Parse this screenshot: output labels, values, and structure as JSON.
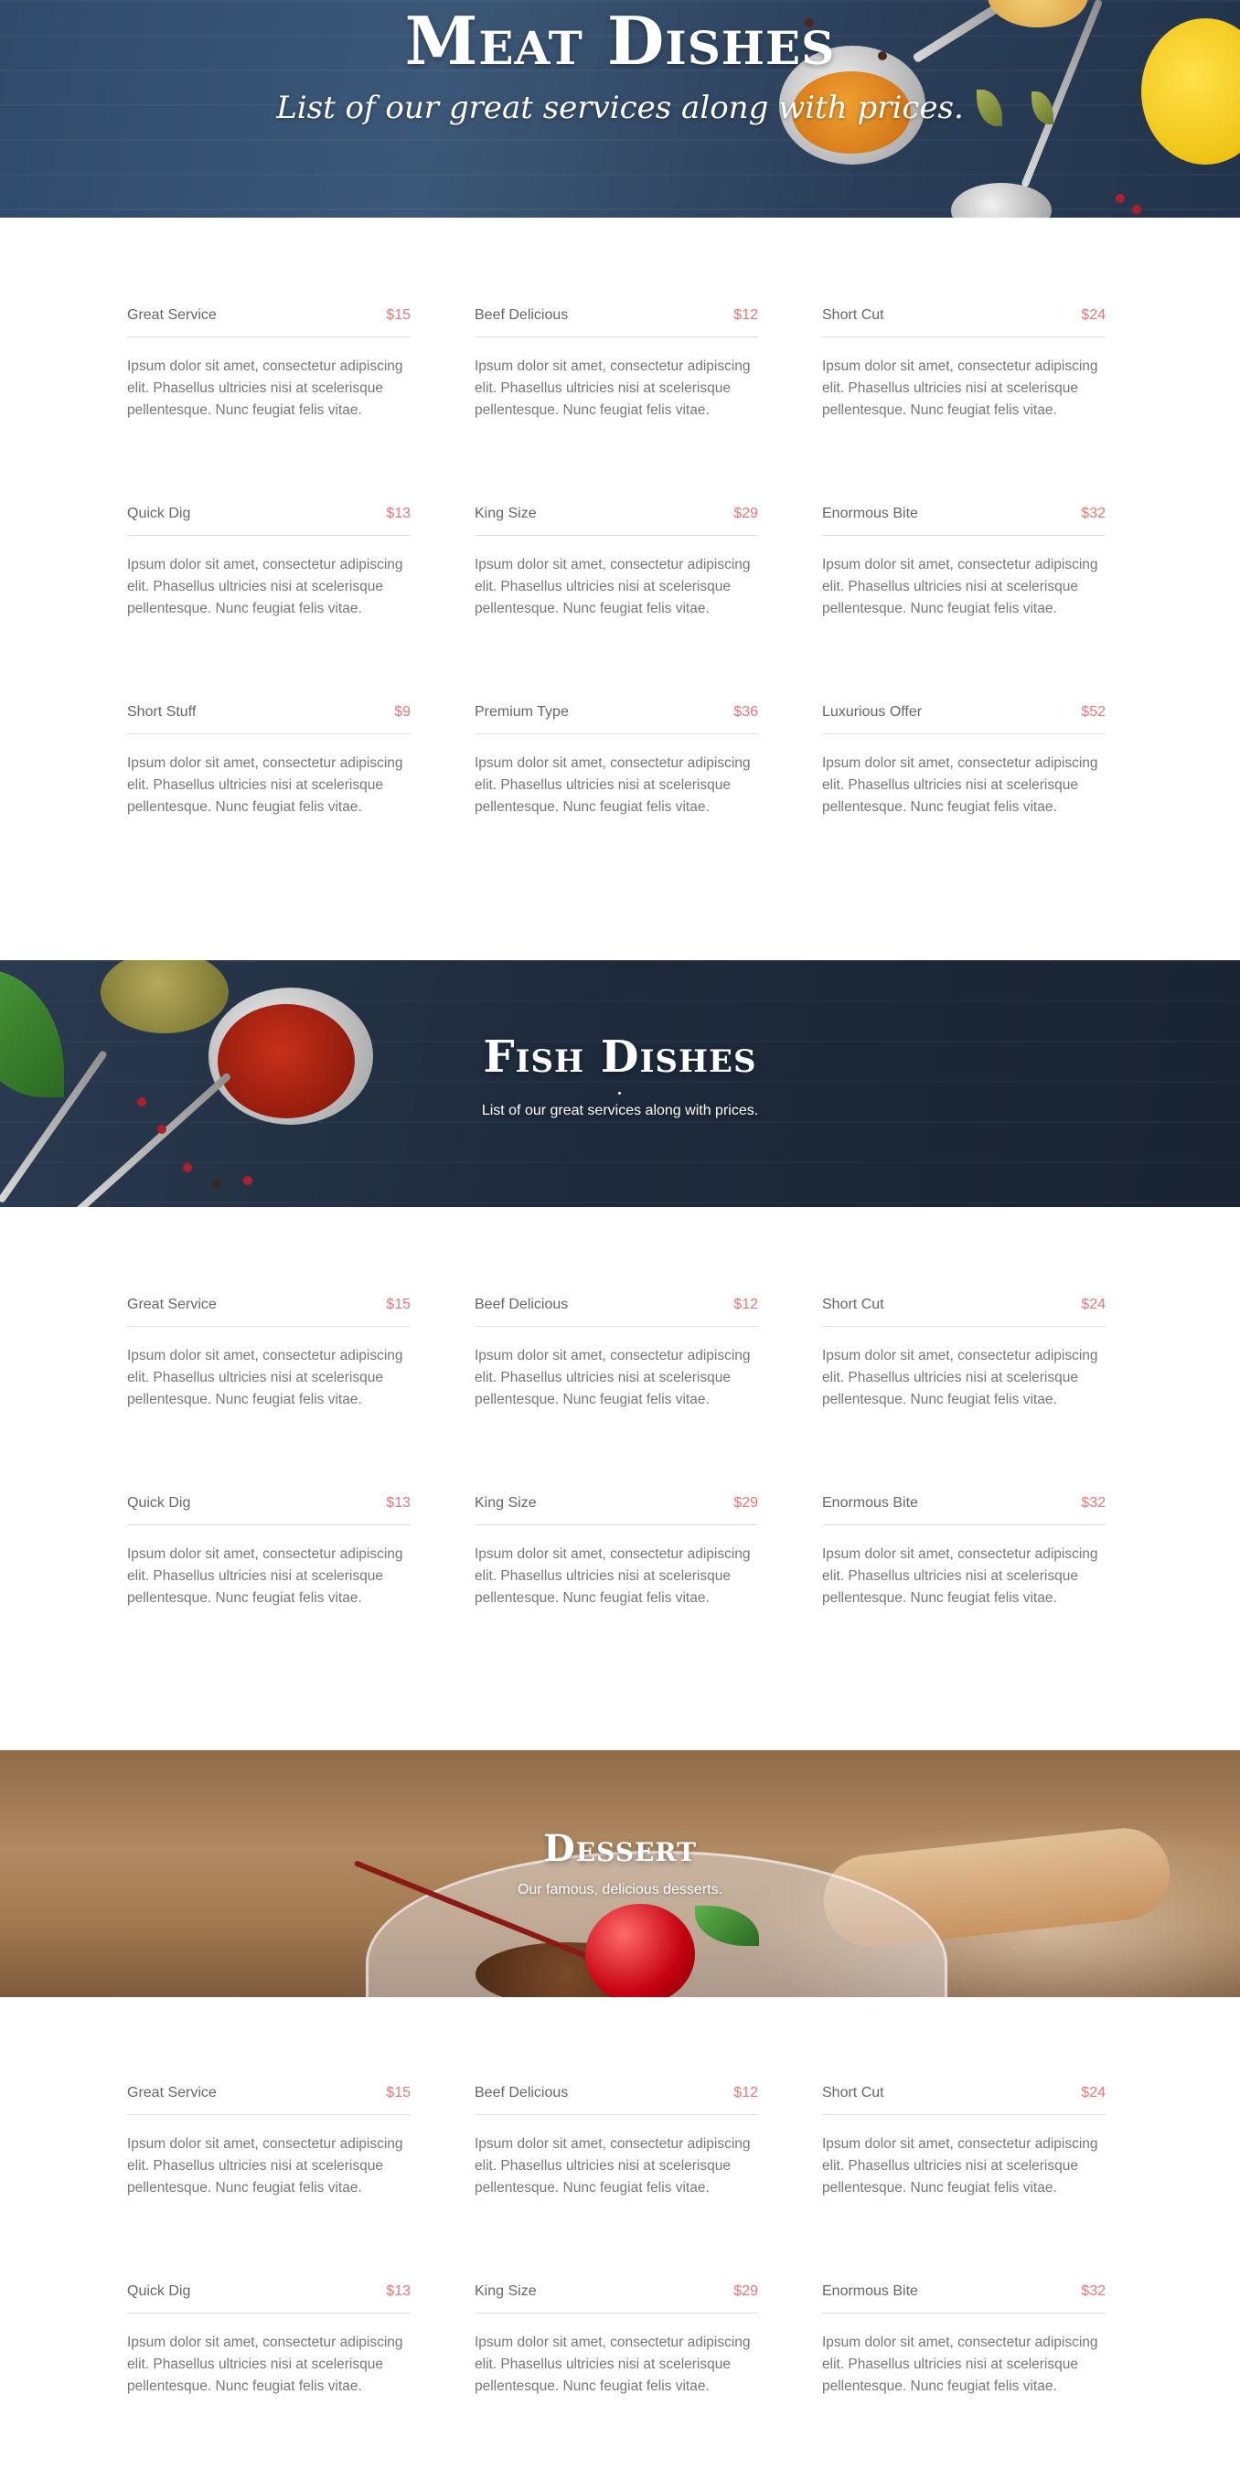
{
  "meat": {
    "title": "Meat Dishes",
    "subtitle": "List of our great services along with prices.",
    "items": [
      {
        "name": "Great Service",
        "price": "$15",
        "desc": "Ipsum dolor sit amet, consectetur adipiscing elit. Phasellus ultricies nisi at scelerisque pellentesque. Nunc feugiat felis vitae."
      },
      {
        "name": "Beef Delicious",
        "price": "$12",
        "desc": "Ipsum dolor sit amet, consectetur adipiscing elit. Phasellus ultricies nisi at scelerisque pellentesque. Nunc feugiat felis vitae."
      },
      {
        "name": "Short Cut",
        "price": "$24",
        "desc": "Ipsum dolor sit amet, consectetur adipiscing elit. Phasellus ultricies nisi at scelerisque pellentesque. Nunc feugiat felis vitae."
      },
      {
        "name": "Quick Dig",
        "price": "$13",
        "desc": "Ipsum dolor sit amet, consectetur adipiscing elit. Phasellus ultricies nisi at scelerisque pellentesque. Nunc feugiat felis vitae."
      },
      {
        "name": "King Size",
        "price": "$29",
        "desc": "Ipsum dolor sit amet, consectetur adipiscing elit. Phasellus ultricies nisi at scelerisque pellentesque. Nunc feugiat felis vitae."
      },
      {
        "name": "Enormous Bite",
        "price": "$32",
        "desc": "Ipsum dolor sit amet, consectetur adipiscing elit. Phasellus ultricies nisi at scelerisque pellentesque. Nunc feugiat felis vitae."
      },
      {
        "name": "Short Stuff",
        "price": "$9",
        "desc": "Ipsum dolor sit amet, consectetur adipiscing elit. Phasellus ultricies nisi at scelerisque pellentesque. Nunc feugiat felis vitae."
      },
      {
        "name": "Premium Type",
        "price": "$36",
        "desc": "Ipsum dolor sit amet, consectetur adipiscing elit. Phasellus ultricies nisi at scelerisque pellentesque. Nunc feugiat felis vitae."
      },
      {
        "name": "Luxurious Offer",
        "price": "$52",
        "desc": "Ipsum dolor sit amet, consectetur adipiscing elit. Phasellus ultricies nisi at scelerisque pellentesque. Nunc feugiat felis vitae."
      }
    ]
  },
  "fish": {
    "title": "Fish Dishes",
    "subtitle": "List of our great services along with prices.",
    "items": [
      {
        "name": "Great Service",
        "price": "$15",
        "desc": "Ipsum dolor sit amet, consectetur adipiscing elit. Phasellus ultricies nisi at scelerisque pellentesque. Nunc feugiat felis vitae."
      },
      {
        "name": "Beef Delicious",
        "price": "$12",
        "desc": "Ipsum dolor sit amet, consectetur adipiscing elit. Phasellus ultricies nisi at scelerisque pellentesque. Nunc feugiat felis vitae."
      },
      {
        "name": "Short Cut",
        "price": "$24",
        "desc": "Ipsum dolor sit amet, consectetur adipiscing elit. Phasellus ultricies nisi at scelerisque pellentesque. Nunc feugiat felis vitae."
      },
      {
        "name": "Quick Dig",
        "price": "$13",
        "desc": "Ipsum dolor sit amet, consectetur adipiscing elit. Phasellus ultricies nisi at scelerisque pellentesque. Nunc feugiat felis vitae."
      },
      {
        "name": "King Size",
        "price": "$29",
        "desc": "Ipsum dolor sit amet, consectetur adipiscing elit. Phasellus ultricies nisi at scelerisque pellentesque. Nunc feugiat felis vitae."
      },
      {
        "name": "Enormous Bite",
        "price": "$32",
        "desc": "Ipsum dolor sit amet, consectetur adipiscing elit. Phasellus ultricies nisi at scelerisque pellentesque. Nunc feugiat felis vitae."
      }
    ]
  },
  "dessert": {
    "title": "Dessert",
    "subtitle": "Our famous, delicious desserts.",
    "items": [
      {
        "name": "Great Service",
        "price": "$15",
        "desc": "Ipsum dolor sit amet, consectetur adipiscing elit. Phasellus ultricies nisi at scelerisque pellentesque. Nunc feugiat felis vitae."
      },
      {
        "name": "Beef Delicious",
        "price": "$12",
        "desc": "Ipsum dolor sit amet, consectetur adipiscing elit. Phasellus ultricies nisi at scelerisque pellentesque. Nunc feugiat felis vitae."
      },
      {
        "name": "Short Cut",
        "price": "$24",
        "desc": "Ipsum dolor sit amet, consectetur adipiscing elit. Phasellus ultricies nisi at scelerisque pellentesque. Nunc feugiat felis vitae."
      },
      {
        "name": "Quick Dig",
        "price": "$13",
        "desc": "Ipsum dolor sit amet, consectetur adipiscing elit. Phasellus ultricies nisi at scelerisque pellentesque. Nunc feugiat felis vitae."
      },
      {
        "name": "King Size",
        "price": "$29",
        "desc": "Ipsum dolor sit amet, consectetur adipiscing elit. Phasellus ultricies nisi at scelerisque pellentesque. Nunc feugiat felis vitae."
      },
      {
        "name": "Enormous Bite",
        "price": "$32",
        "desc": "Ipsum dolor sit amet, consectetur adipiscing elit. Phasellus ultricies nisi at scelerisque pellentesque. Nunc feugiat felis vitae."
      }
    ]
  },
  "colors": {
    "price": "#e97777",
    "text": "#777777",
    "divider": "#dddddd"
  }
}
